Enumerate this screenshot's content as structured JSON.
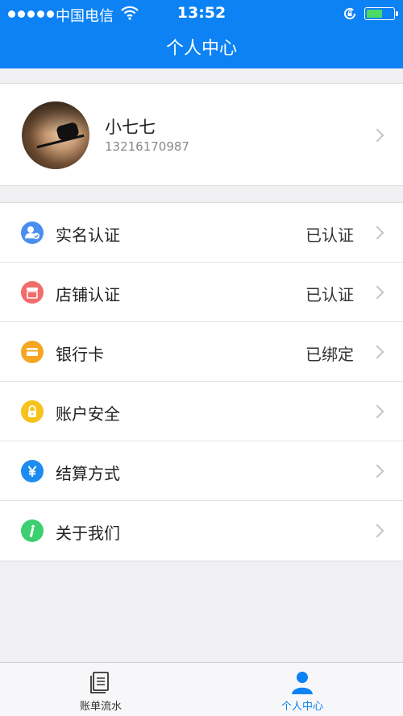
{
  "status_bar": {
    "carrier": "中国电信",
    "time": "13:52",
    "battery_percent": 60
  },
  "header": {
    "title": "个人中心"
  },
  "profile": {
    "name": "小七七",
    "phone": "13216170987"
  },
  "menu": [
    {
      "label": "实名认证",
      "value": "已认证",
      "icon": "id-verify-icon",
      "color": "#4a8ff0"
    },
    {
      "label": "店铺认证",
      "value": "已认证",
      "icon": "store-icon",
      "color": "#f26c6c"
    },
    {
      "label": "银行卡",
      "value": "已绑定",
      "icon": "bank-card-icon",
      "color": "#f5a623"
    },
    {
      "label": "账户安全",
      "value": "",
      "icon": "lock-icon",
      "color": "#f7c21b"
    },
    {
      "label": "结算方式",
      "value": "",
      "icon": "yen-icon",
      "color": "#1d8cf0"
    },
    {
      "label": "关于我们",
      "value": "",
      "icon": "info-icon",
      "color": "#3ccf72"
    }
  ],
  "tabs": [
    {
      "label": "账单流水",
      "icon": "bill-list-icon",
      "active": false
    },
    {
      "label": "个人中心",
      "icon": "person-icon",
      "active": true
    }
  ],
  "colors": {
    "accent": "#0c82f4",
    "active_tab": "#0c82f4",
    "inactive_tab": "#333333"
  }
}
